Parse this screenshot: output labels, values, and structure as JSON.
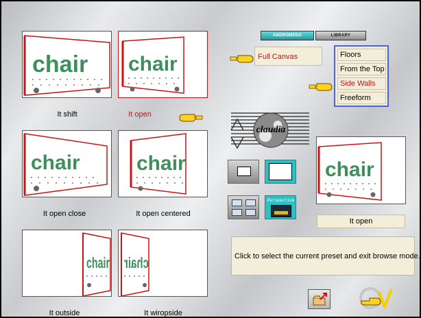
{
  "tabs": [
    {
      "label": "ANDROMEDA",
      "active": true
    },
    {
      "label": "LIBRARY",
      "active": false
    }
  ],
  "presets": [
    {
      "label": "It shift",
      "selected": false
    },
    {
      "label": "It open",
      "selected": true
    },
    {
      "label": "It open close",
      "selected": false
    },
    {
      "label": "It open centered",
      "selected": false
    },
    {
      "label": "It outside",
      "selected": false
    },
    {
      "label": "It wiropside",
      "selected": false
    }
  ],
  "thumbnail_text": "chair",
  "canvas_mode": {
    "label": "Full Canvas",
    "selected": true
  },
  "canvas_sub_options": [
    {
      "label": "Floors",
      "selected": false
    },
    {
      "label": "From the Top",
      "selected": false
    },
    {
      "label": "Side Walls",
      "selected": true
    },
    {
      "label": "Freeform",
      "selected": false
    }
  ],
  "watermark": "claudia",
  "perspective_button": "Perspective",
  "preview": {
    "label": "It open"
  },
  "hint_text": "Click to select the current preset and exit browse mode.",
  "colors": {
    "accent_red": "#d01010",
    "selection_blue": "#4a63d8",
    "panel_cream": "#f3eeda",
    "chair_green": "#3f8f5e",
    "tab_teal": "#1e9aa2"
  },
  "icons": {
    "pointer": "pointing-hand-icon",
    "folder": "open-folder-icon",
    "confirm": "checkmark-v-icon"
  }
}
